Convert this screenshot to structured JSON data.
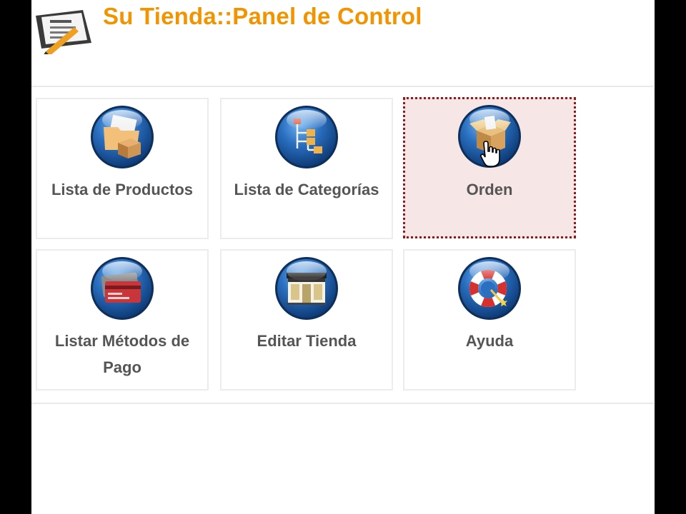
{
  "header": {
    "title": "Su Tienda::Panel de Control",
    "icon": "notepad-pencil-icon"
  },
  "tiles": [
    {
      "label": "Lista de Productos",
      "icon": "folder-box-icon",
      "active": false
    },
    {
      "label": "Lista de Categorías",
      "icon": "category-tree-icon",
      "active": false
    },
    {
      "label": "Orden",
      "icon": "open-box-icon",
      "active": true
    },
    {
      "label": "Listar Métodos de Pago",
      "icon": "credit-cards-icon",
      "active": false
    },
    {
      "label": "Editar Tienda",
      "icon": "storefront-icon",
      "active": false
    },
    {
      "label": "Ayuda",
      "icon": "life-buoy-icon",
      "active": false
    }
  ],
  "colors": {
    "title": "#f29400",
    "orb": "#1c5ea8",
    "active_tile_bg": "#f6e6e6",
    "active_tile_border": "#8a1e1e"
  }
}
